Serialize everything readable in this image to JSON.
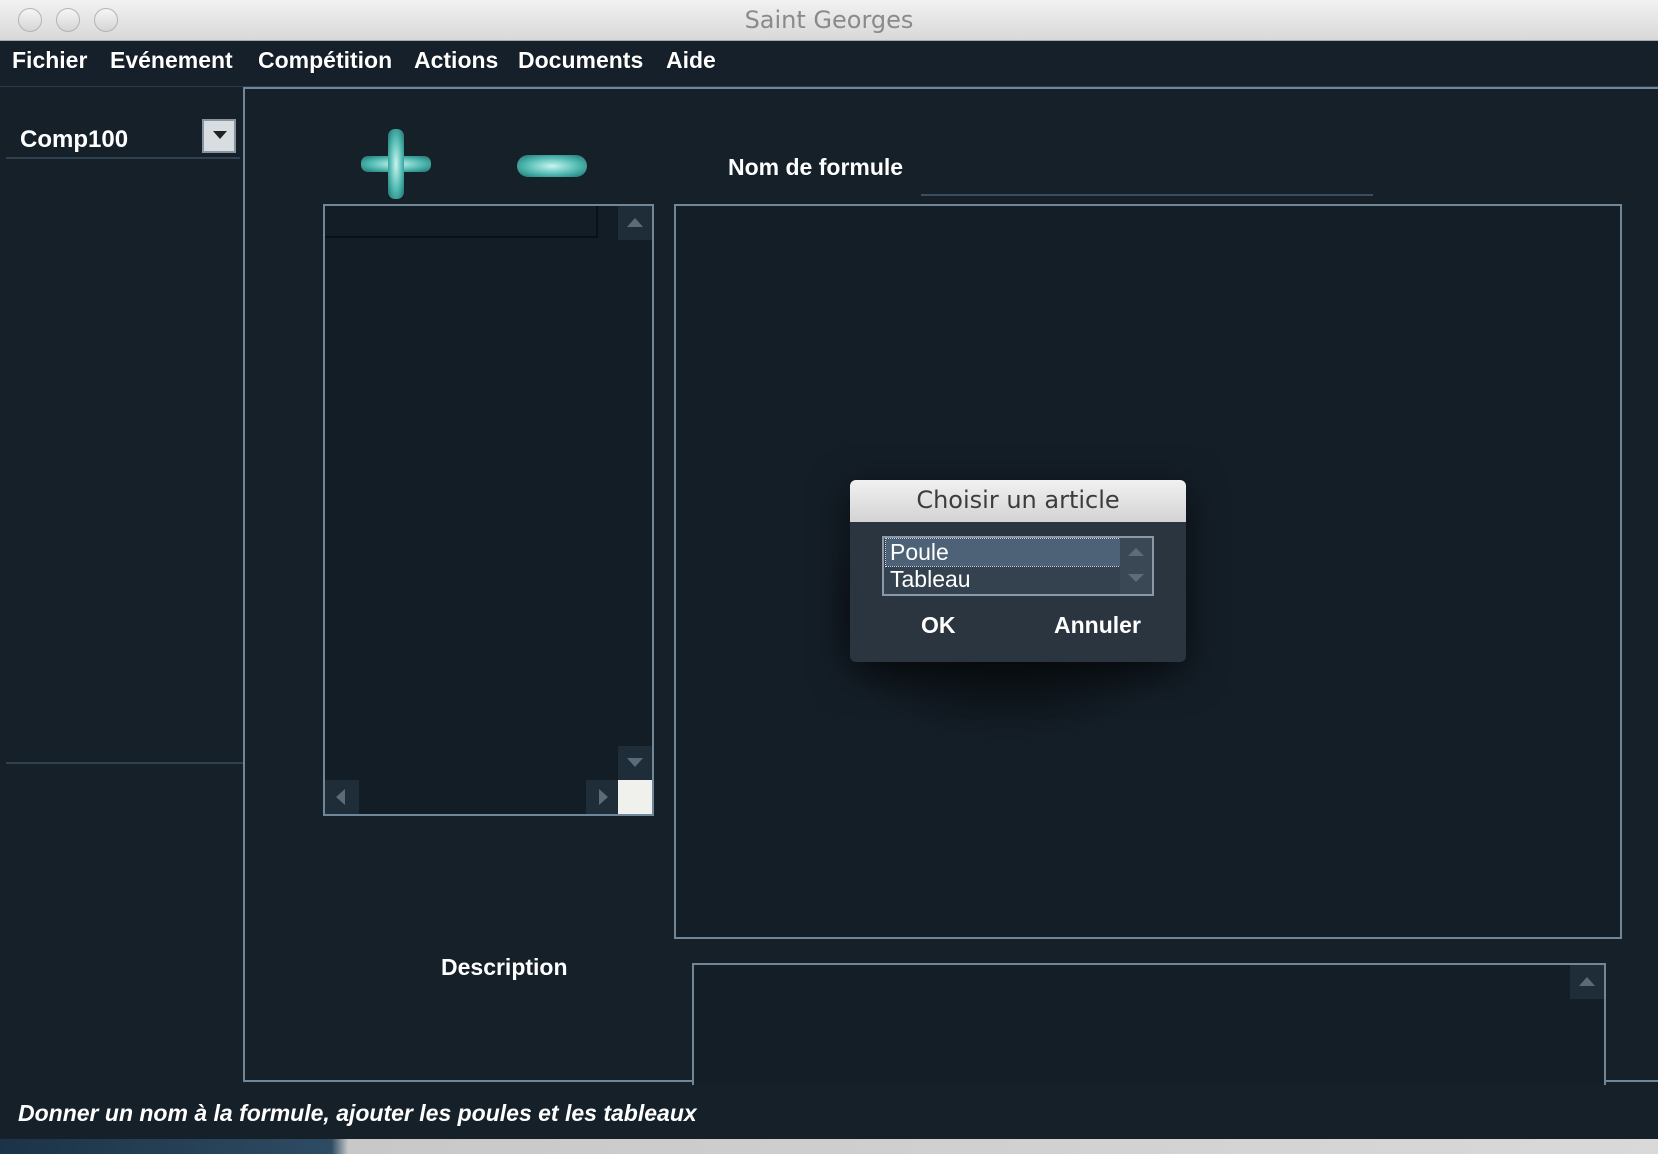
{
  "window": {
    "title": "Saint Georges"
  },
  "menu": {
    "items": [
      "Fichier",
      "Evénement",
      "Compétition",
      "Actions",
      "Documents",
      "Aide"
    ]
  },
  "sidebar": {
    "competition_selected": "Comp100"
  },
  "main": {
    "formula_label": "Nom de formule",
    "formula_value": "",
    "description_label": "Description",
    "description_value": ""
  },
  "status_bar": {
    "text": "Donner un nom à la formule, ajouter les poules et les tableaux"
  },
  "dialog": {
    "title": "Choisir un article",
    "options": [
      "Poule",
      "Tableau"
    ],
    "selected": "Poule",
    "ok_label": "OK",
    "cancel_label": "Annuler"
  },
  "icons": {
    "add": "plus-icon",
    "remove": "minus-icon"
  },
  "colors": {
    "accent": "#4fb8b0",
    "border": "#6f8798",
    "background": "#152029"
  }
}
